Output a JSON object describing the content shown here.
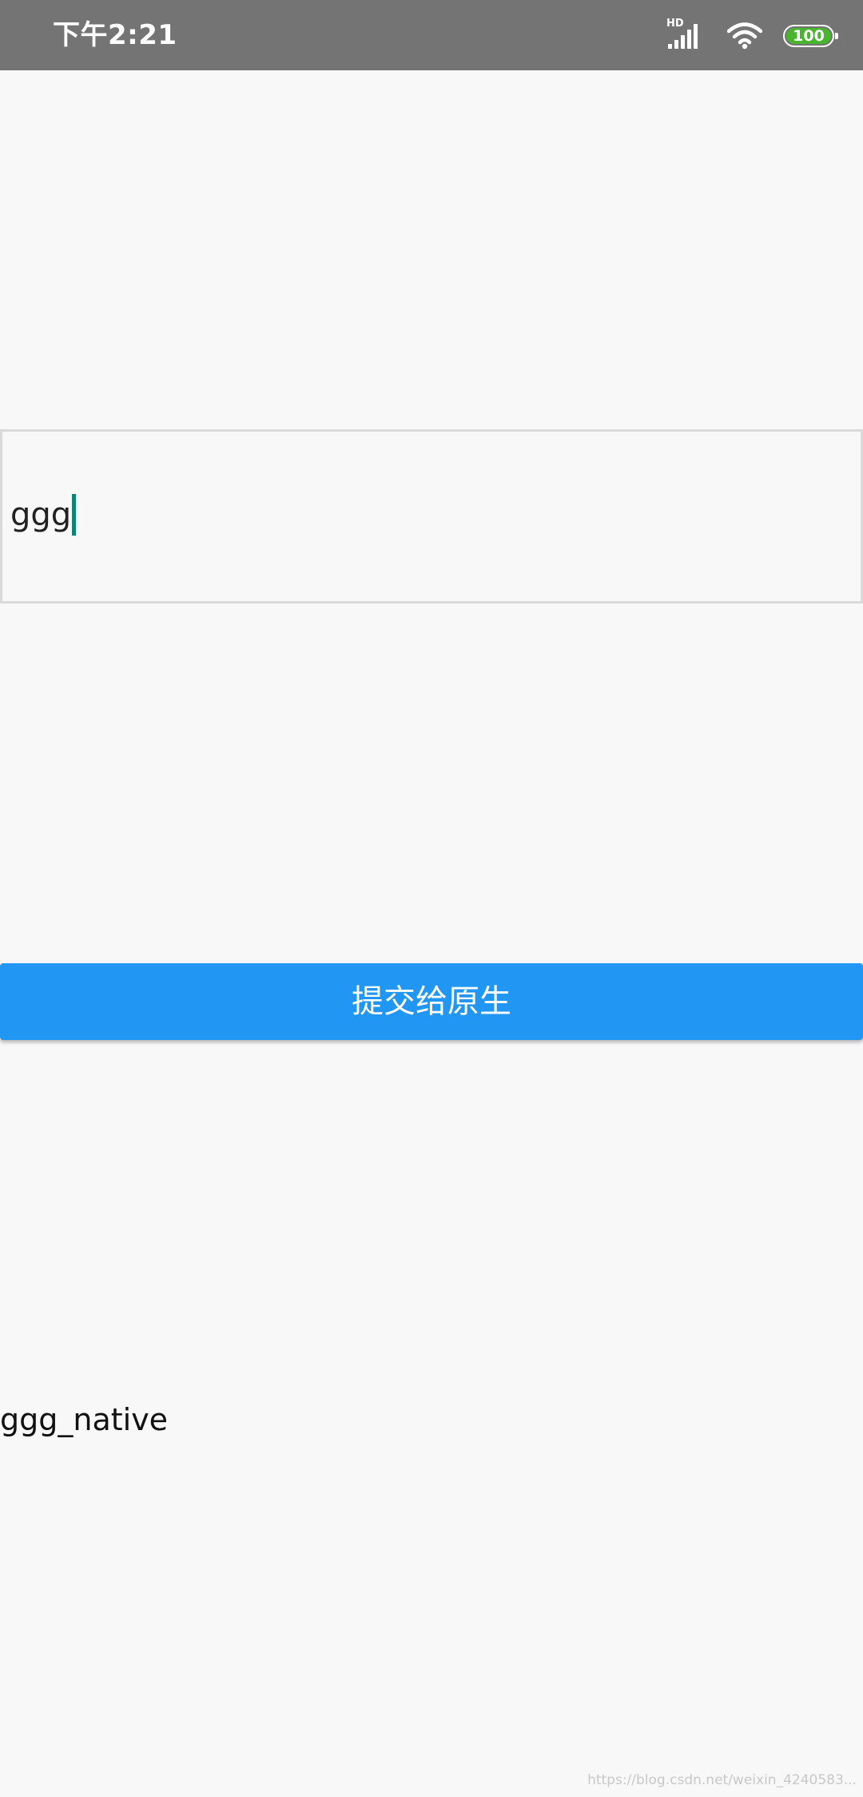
{
  "status_bar": {
    "time": "下午2:21",
    "network_label": "HD",
    "battery_level": "100",
    "colors": {
      "background": "#747474",
      "battery": "#49b52f"
    }
  },
  "input": {
    "value": "ggg",
    "caret_color": "#0c8576"
  },
  "submit_button": {
    "label": "提交给原生",
    "color": "#2196f3"
  },
  "result": {
    "text": "ggg_native"
  },
  "watermark": {
    "text": "https://blog.csdn.net/weixin_4240583..."
  }
}
